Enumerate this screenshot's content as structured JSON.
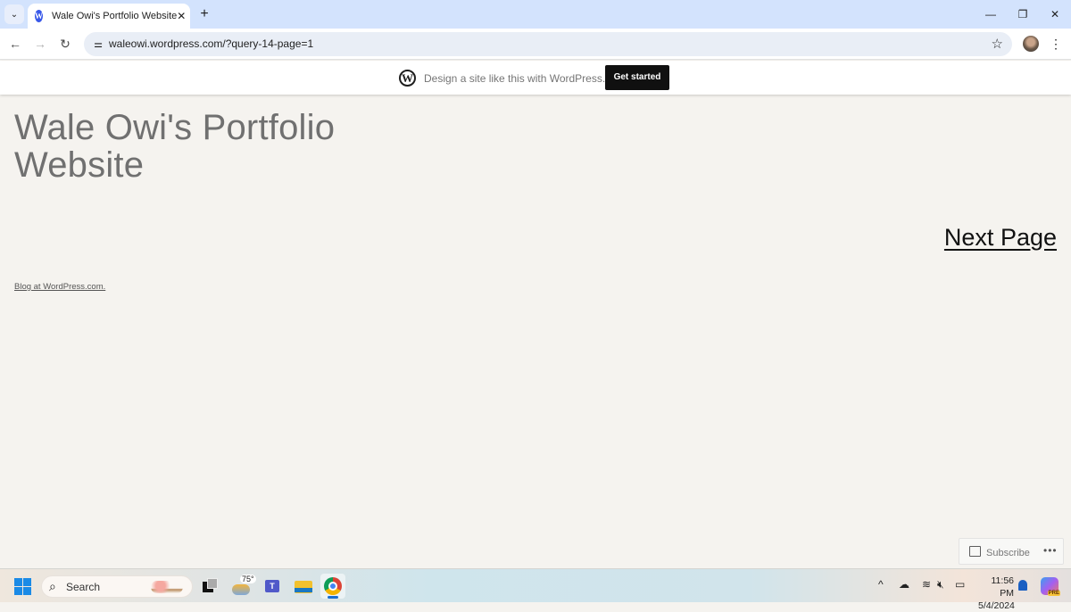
{
  "browser": {
    "tab": {
      "title": "Wale Owi's Portfolio Website",
      "favicon": "wordpress-icon",
      "close": "✕"
    },
    "new_tab": "+",
    "tab_search": "⌄",
    "window_controls": {
      "minimize": "—",
      "restore": "❐",
      "close": "✕"
    },
    "nav": {
      "back": "←",
      "forward": "→",
      "reload": "↻"
    },
    "site_info_icon": "⚌",
    "url": "waleowi.wordpress.com/?query-14-page=1",
    "bookmark_icon": "☆",
    "menu_icon": "⋮"
  },
  "wp_banner": {
    "logo": "W",
    "tagline": "Design a site like this with WordPress.com",
    "cta": "Get started"
  },
  "page": {
    "site_title": "Wale Owi's Portfolio Website",
    "next_page": "Next Page",
    "footer_link": "Blog at WordPress.com."
  },
  "subscribe": {
    "label": "Subscribe",
    "more": "•••"
  },
  "taskbar": {
    "search_placeholder": "Search",
    "search_icon": "⌕",
    "weather_temp": "75°",
    "teams_letter": "T",
    "tray": {
      "chevron": "^",
      "cloud": "☁",
      "wifi": "≋",
      "volume": "🔇︎",
      "battery": "▭"
    },
    "clock": {
      "time": "11:56 PM",
      "date": "5/4/2024"
    },
    "copilot_badge": "PRE"
  }
}
